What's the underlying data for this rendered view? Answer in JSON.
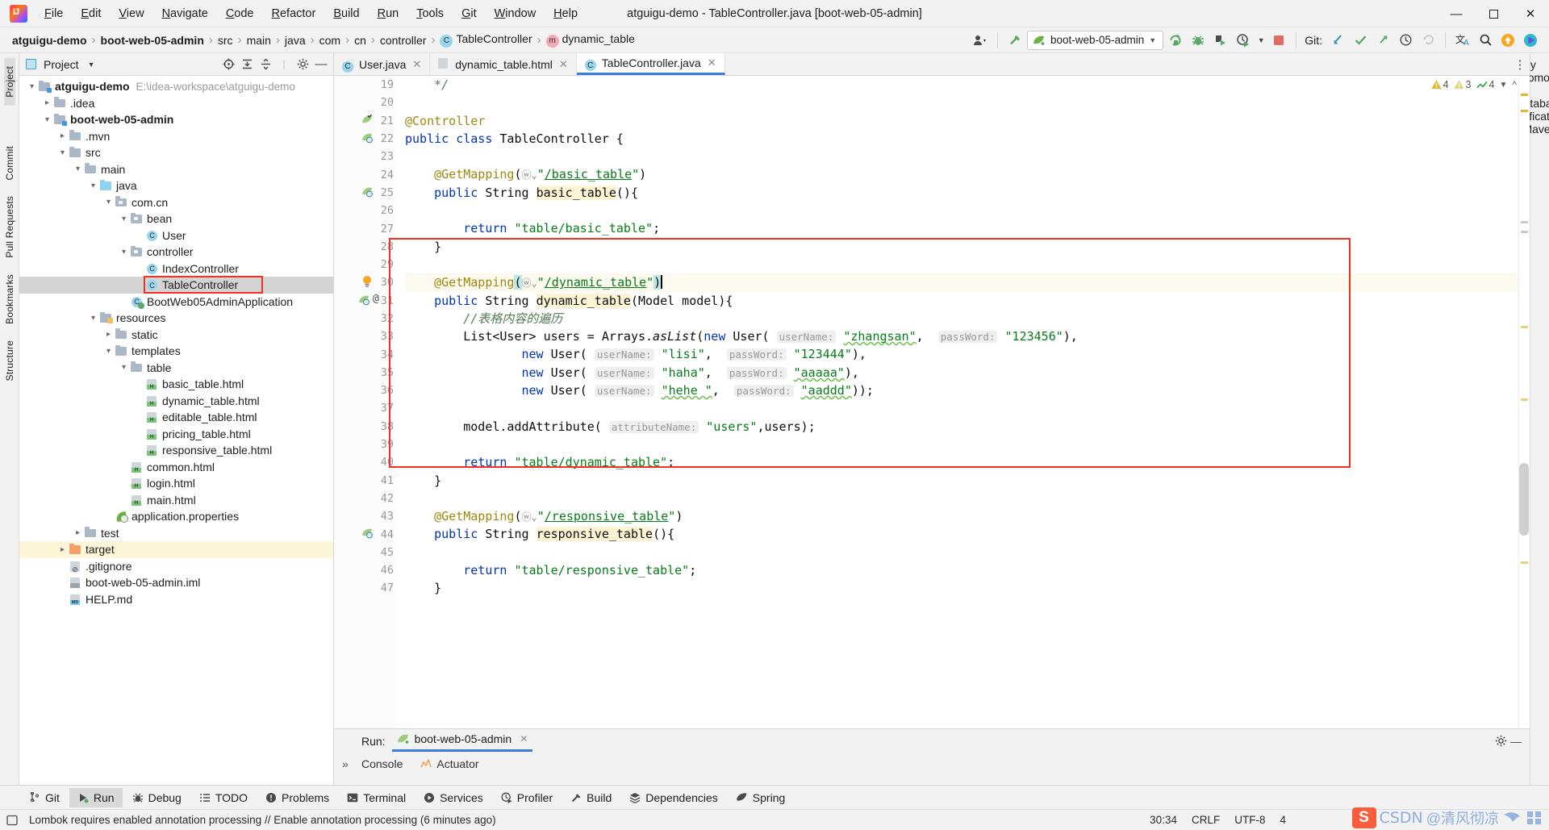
{
  "window": {
    "title": "atguigu-demo - TableController.java [boot-web-05-admin]",
    "minimize": "—",
    "maximize": "❐",
    "close": "✕"
  },
  "menu": [
    "File",
    "Edit",
    "View",
    "Navigate",
    "Code",
    "Refactor",
    "Build",
    "Run",
    "Tools",
    "Git",
    "Window",
    "Help"
  ],
  "breadcrumb": [
    {
      "label": "atguigu-demo",
      "bold": true
    },
    {
      "label": "boot-web-05-admin",
      "bold": true
    },
    {
      "label": "src",
      "bold": false
    },
    {
      "label": "main",
      "bold": false
    },
    {
      "label": "java",
      "bold": false
    },
    {
      "label": "com",
      "bold": false
    },
    {
      "label": "cn",
      "bold": false
    },
    {
      "label": "controller",
      "bold": false
    },
    {
      "label": "TableController",
      "bold": false,
      "icon": "class-icon"
    },
    {
      "label": "dynamic_table",
      "bold": false,
      "icon": "method-icon"
    }
  ],
  "toolbar": {
    "run_config": "boot-web-05-admin",
    "git_label": "Git:"
  },
  "project_panel": {
    "title": "Project",
    "tree": [
      {
        "depth": 0,
        "arrow": "down",
        "icon": "module-folder",
        "label": "atguigu-demo",
        "bold": true,
        "path": "E:\\idea-workspace\\atguigu-demo"
      },
      {
        "depth": 1,
        "arrow": "right",
        "icon": "folder",
        "label": ".idea"
      },
      {
        "depth": 1,
        "arrow": "down",
        "icon": "module-folder",
        "label": "boot-web-05-admin",
        "bold": true
      },
      {
        "depth": 2,
        "arrow": "right",
        "icon": "folder",
        "label": ".mvn"
      },
      {
        "depth": 2,
        "arrow": "down",
        "icon": "folder",
        "label": "src"
      },
      {
        "depth": 3,
        "arrow": "down",
        "icon": "folder",
        "label": "main"
      },
      {
        "depth": 4,
        "arrow": "down",
        "icon": "source-folder",
        "label": "java"
      },
      {
        "depth": 5,
        "arrow": "down",
        "icon": "package",
        "label": "com.cn"
      },
      {
        "depth": 6,
        "arrow": "down",
        "icon": "package",
        "label": "bean"
      },
      {
        "depth": 7,
        "arrow": "none",
        "icon": "class",
        "label": "User"
      },
      {
        "depth": 6,
        "arrow": "down",
        "icon": "package",
        "label": "controller"
      },
      {
        "depth": 7,
        "arrow": "none",
        "icon": "class",
        "label": "IndexController"
      },
      {
        "depth": 7,
        "arrow": "none",
        "icon": "class",
        "label": "TableController",
        "selected": true,
        "boxed": true
      },
      {
        "depth": 6,
        "arrow": "none",
        "icon": "class-run",
        "label": "BootWeb05AdminApplication"
      },
      {
        "depth": 4,
        "arrow": "down",
        "icon": "resources-folder",
        "label": "resources"
      },
      {
        "depth": 5,
        "arrow": "right",
        "icon": "folder",
        "label": "static"
      },
      {
        "depth": 5,
        "arrow": "down",
        "icon": "folder",
        "label": "templates"
      },
      {
        "depth": 6,
        "arrow": "down",
        "icon": "folder",
        "label": "table"
      },
      {
        "depth": 7,
        "arrow": "none",
        "icon": "html",
        "label": "basic_table.html"
      },
      {
        "depth": 7,
        "arrow": "none",
        "icon": "html",
        "label": "dynamic_table.html"
      },
      {
        "depth": 7,
        "arrow": "none",
        "icon": "html",
        "label": "editable_table.html"
      },
      {
        "depth": 7,
        "arrow": "none",
        "icon": "html",
        "label": "pricing_table.html"
      },
      {
        "depth": 7,
        "arrow": "none",
        "icon": "html",
        "label": "responsive_table.html"
      },
      {
        "depth": 6,
        "arrow": "none",
        "icon": "html",
        "label": "common.html"
      },
      {
        "depth": 6,
        "arrow": "none",
        "icon": "html",
        "label": "login.html"
      },
      {
        "depth": 6,
        "arrow": "none",
        "icon": "html",
        "label": "main.html"
      },
      {
        "depth": 5,
        "arrow": "none",
        "icon": "spring-properties",
        "label": "application.properties"
      },
      {
        "depth": 3,
        "arrow": "right",
        "icon": "folder",
        "label": "test"
      },
      {
        "depth": 2,
        "arrow": "right",
        "icon": "folder-orange",
        "label": "target",
        "highlighted": true
      },
      {
        "depth": 2,
        "arrow": "none",
        "icon": "gitignore",
        "label": ".gitignore"
      },
      {
        "depth": 2,
        "arrow": "none",
        "icon": "iml",
        "label": "boot-web-05-admin.iml"
      },
      {
        "depth": 2,
        "arrow": "none",
        "icon": "markdown",
        "label": "HELP.md"
      }
    ]
  },
  "left_rail": [
    "Project",
    "Commit",
    "Pull Requests",
    "Bookmarks",
    "Structure"
  ],
  "right_rail": [
    "Key Promoter X",
    "Database",
    "Notifications",
    "Maven"
  ],
  "editor": {
    "tabs": [
      {
        "label": "User.java",
        "icon": "class-icon",
        "active": false
      },
      {
        "label": "dynamic_table.html",
        "icon": "html-icon",
        "active": false
      },
      {
        "label": "TableController.java",
        "icon": "class-icon",
        "active": true
      }
    ],
    "inspections": {
      "warnings": "4",
      "weak_warnings": "3",
      "typos": "4"
    },
    "first_line_number": 19,
    "lines": [
      {
        "n": 19,
        "segs": [
          {
            "t": "    ",
            "c": ""
          },
          {
            "t": "*/",
            "c": "cmtg"
          }
        ]
      },
      {
        "n": 20,
        "segs": []
      },
      {
        "n": 21,
        "segs": [
          {
            "t": "@Controller",
            "c": "ann"
          }
        ],
        "gutter": "spring-bean"
      },
      {
        "n": 22,
        "segs": [
          {
            "t": "public ",
            "c": "kw"
          },
          {
            "t": "class ",
            "c": "kw"
          },
          {
            "t": "TableController {",
            "c": ""
          }
        ],
        "gutter": "spring-impl"
      },
      {
        "n": 23,
        "segs": []
      },
      {
        "n": 24,
        "segs": [
          {
            "t": "    ",
            "c": ""
          },
          {
            "t": "@GetMapping",
            "c": "ann"
          },
          {
            "t": "(",
            "c": ""
          },
          {
            "t": "ⓦ⌄",
            "c": "globe"
          },
          {
            "t": "\"",
            "c": "str"
          },
          {
            "t": "/basic_table",
            "c": "link"
          },
          {
            "t": "\"",
            "c": "str"
          },
          {
            "t": ")",
            "c": ""
          }
        ]
      },
      {
        "n": 25,
        "segs": [
          {
            "t": "    ",
            "c": ""
          },
          {
            "t": "public ",
            "c": "kw"
          },
          {
            "t": "String ",
            "c": ""
          },
          {
            "t": "basic_table",
            "c": "hlid"
          },
          {
            "t": "(){",
            "c": ""
          }
        ],
        "gutter": "spring-url"
      },
      {
        "n": 26,
        "segs": []
      },
      {
        "n": 27,
        "segs": [
          {
            "t": "        ",
            "c": ""
          },
          {
            "t": "return ",
            "c": "kw"
          },
          {
            "t": "\"table/basic_table\"",
            "c": "str"
          },
          {
            "t": ";",
            "c": ""
          }
        ]
      },
      {
        "n": 28,
        "segs": [
          {
            "t": "    }",
            "c": ""
          }
        ]
      },
      {
        "n": 29,
        "segs": []
      },
      {
        "n": 30,
        "segs": [
          {
            "t": "    ",
            "c": ""
          },
          {
            "t": "@GetMapping",
            "c": "ann"
          },
          {
            "t": "(",
            "c": "selpar"
          },
          {
            "t": "ⓦ⌄",
            "c": "globe"
          },
          {
            "t": "\"",
            "c": "str"
          },
          {
            "t": "/dynamic_table",
            "c": "link"
          },
          {
            "t": "\"",
            "c": "str"
          },
          {
            "t": ")",
            "c": "selpar"
          }
        ],
        "caret": true,
        "bulb": true
      },
      {
        "n": 31,
        "segs": [
          {
            "t": "    ",
            "c": ""
          },
          {
            "t": "public ",
            "c": "kw"
          },
          {
            "t": "String ",
            "c": ""
          },
          {
            "t": "dynamic_table",
            "c": "hlid"
          },
          {
            "t": "(Model model){",
            "c": ""
          }
        ],
        "gutter": "spring-url-at"
      },
      {
        "n": 32,
        "segs": [
          {
            "t": "        ",
            "c": ""
          },
          {
            "t": "//表格内容的遍历",
            "c": "cmtg"
          }
        ]
      },
      {
        "n": 33,
        "segs": [
          {
            "t": "        List<User> users = Arrays.",
            "c": ""
          },
          {
            "t": "asList",
            "c": "statik"
          },
          {
            "t": "(",
            "c": ""
          },
          {
            "t": "new ",
            "c": "kw"
          },
          {
            "t": "User( ",
            "c": ""
          },
          {
            "t": "userName:",
            "c": "param"
          },
          {
            "t": " ",
            "c": ""
          },
          {
            "t": "\"zhangsan\"",
            "c": "str-squig"
          },
          {
            "t": ",  ",
            "c": ""
          },
          {
            "t": "passWord:",
            "c": "param"
          },
          {
            "t": " ",
            "c": ""
          },
          {
            "t": "\"123456\"",
            "c": "str"
          },
          {
            "t": "),",
            "c": ""
          }
        ]
      },
      {
        "n": 34,
        "segs": [
          {
            "t": "                ",
            "c": ""
          },
          {
            "t": "new ",
            "c": "kw"
          },
          {
            "t": "User( ",
            "c": ""
          },
          {
            "t": "userName:",
            "c": "param"
          },
          {
            "t": " ",
            "c": ""
          },
          {
            "t": "\"lisi\"",
            "c": "str"
          },
          {
            "t": ",  ",
            "c": ""
          },
          {
            "t": "passWord:",
            "c": "param"
          },
          {
            "t": " ",
            "c": ""
          },
          {
            "t": "\"123444\"",
            "c": "str"
          },
          {
            "t": "),",
            "c": ""
          }
        ]
      },
      {
        "n": 35,
        "segs": [
          {
            "t": "                ",
            "c": ""
          },
          {
            "t": "new ",
            "c": "kw"
          },
          {
            "t": "User( ",
            "c": ""
          },
          {
            "t": "userName:",
            "c": "param"
          },
          {
            "t": " ",
            "c": ""
          },
          {
            "t": "\"haha\"",
            "c": "str"
          },
          {
            "t": ",  ",
            "c": ""
          },
          {
            "t": "passWord:",
            "c": "param"
          },
          {
            "t": " ",
            "c": ""
          },
          {
            "t": "\"aaaaa\"",
            "c": "str-squig"
          },
          {
            "t": "),",
            "c": ""
          }
        ]
      },
      {
        "n": 36,
        "segs": [
          {
            "t": "                ",
            "c": ""
          },
          {
            "t": "new ",
            "c": "kw"
          },
          {
            "t": "User( ",
            "c": ""
          },
          {
            "t": "userName:",
            "c": "param"
          },
          {
            "t": " ",
            "c": ""
          },
          {
            "t": "\"hehe \"",
            "c": "str-squig"
          },
          {
            "t": ",  ",
            "c": ""
          },
          {
            "t": "passWord:",
            "c": "param"
          },
          {
            "t": " ",
            "c": ""
          },
          {
            "t": "\"aaddd\"",
            "c": "str-squig"
          },
          {
            "t": "));",
            "c": ""
          }
        ]
      },
      {
        "n": 37,
        "segs": []
      },
      {
        "n": 38,
        "segs": [
          {
            "t": "        model.addAttribute( ",
            "c": ""
          },
          {
            "t": "attributeName:",
            "c": "param"
          },
          {
            "t": " ",
            "c": ""
          },
          {
            "t": "\"users\"",
            "c": "str"
          },
          {
            "t": ",users);",
            "c": ""
          }
        ]
      },
      {
        "n": 39,
        "segs": []
      },
      {
        "n": 40,
        "segs": [
          {
            "t": "        ",
            "c": ""
          },
          {
            "t": "return ",
            "c": "kw"
          },
          {
            "t": "\"table/dynamic_table\"",
            "c": "str"
          },
          {
            "t": ";",
            "c": ""
          }
        ]
      },
      {
        "n": 41,
        "segs": [
          {
            "t": "    }",
            "c": ""
          }
        ]
      },
      {
        "n": 42,
        "segs": []
      },
      {
        "n": 43,
        "segs": [
          {
            "t": "    ",
            "c": ""
          },
          {
            "t": "@GetMapping",
            "c": "ann"
          },
          {
            "t": "(",
            "c": ""
          },
          {
            "t": "ⓦ⌄",
            "c": "globe"
          },
          {
            "t": "\"",
            "c": "str"
          },
          {
            "t": "/responsive_table",
            "c": "link"
          },
          {
            "t": "\"",
            "c": "str"
          },
          {
            "t": ")",
            "c": ""
          }
        ]
      },
      {
        "n": 44,
        "segs": [
          {
            "t": "    ",
            "c": ""
          },
          {
            "t": "public ",
            "c": "kw"
          },
          {
            "t": "String ",
            "c": ""
          },
          {
            "t": "responsive_table",
            "c": "hlid"
          },
          {
            "t": "(){",
            "c": ""
          }
        ],
        "gutter": "spring-url"
      },
      {
        "n": 45,
        "segs": []
      },
      {
        "n": 46,
        "segs": [
          {
            "t": "        ",
            "c": ""
          },
          {
            "t": "return ",
            "c": "kw"
          },
          {
            "t": "\"table/responsive_table\"",
            "c": "str"
          },
          {
            "t": ";",
            "c": ""
          }
        ]
      },
      {
        "n": 47,
        "segs": [
          {
            "t": "    }",
            "c": ""
          }
        ]
      }
    ]
  },
  "run_panel": {
    "label": "Run:",
    "config_name": "boot-web-05-admin",
    "close": "✕",
    "expand": "»",
    "sub_tabs": [
      "Console",
      "Actuator"
    ]
  },
  "bottom_bar": [
    {
      "label": "Git",
      "icon": "git-icon",
      "selected": false
    },
    {
      "label": "Run",
      "icon": "run-icon",
      "selected": true
    },
    {
      "label": "Debug",
      "icon": "debug-icon",
      "selected": false
    },
    {
      "label": "TODO",
      "icon": "todo-icon",
      "selected": false
    },
    {
      "label": "Problems",
      "icon": "problems-icon",
      "selected": false
    },
    {
      "label": "Terminal",
      "icon": "terminal-icon",
      "selected": false
    },
    {
      "label": "Services",
      "icon": "services-icon",
      "selected": false
    },
    {
      "label": "Profiler",
      "icon": "profiler-icon",
      "selected": false
    },
    {
      "label": "Build",
      "icon": "build-icon",
      "selected": false
    },
    {
      "label": "Dependencies",
      "icon": "dependencies-icon",
      "selected": false
    },
    {
      "label": "Spring",
      "icon": "spring-icon",
      "selected": false
    }
  ],
  "status_bar": {
    "message": "Lombok requires enabled annotation processing // Enable annotation processing (6 minutes ago)",
    "caret_position": "30:34",
    "line_separator": "CRLF",
    "encoding": "UTF-8",
    "indent": "4"
  },
  "watermark": {
    "brand": "CSDN",
    "author": "@清风彻凉"
  },
  "colors": {
    "accent_blue": "#3b7ddd",
    "red_box": "#ee3124",
    "string_green": "#067d17",
    "keyword_blue": "#0033b3",
    "annotation_gold": "#9e880d",
    "selection_gray": "#d4d4d4",
    "highlight_yellow": "#fdf6d8"
  }
}
